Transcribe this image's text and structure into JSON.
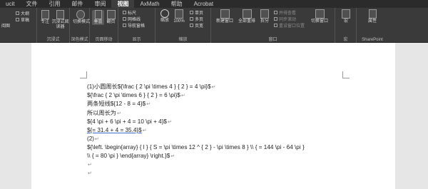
{
  "ribbon": {
    "tabs": [
      "ucit",
      "文件",
      "引用",
      "邮件",
      "审阅",
      "视图",
      "AxMath",
      "帮助",
      "Acrobat"
    ],
    "active_tab": "视图",
    "groups": {
      "immersive": {
        "label": "沉浸式",
        "buttons": [
          "专注",
          "沉浸式阅读器"
        ],
        "left_items": [
          "大纲",
          "草稿"
        ],
        "far_left": "阅图"
      },
      "dark": {
        "label": "深色模式",
        "buttons": [
          "切换模式"
        ]
      },
      "page_move": {
        "label": "页面移动",
        "buttons": [
          "垂直",
          "翻页"
        ]
      },
      "show": {
        "label": "显示",
        "checks": [
          "标尺",
          "网格线",
          "导航窗格"
        ]
      },
      "zoom": {
        "label": "缩放",
        "buttons": [
          "缩放",
          "100%"
        ],
        "items": [
          "单页",
          "多页",
          "页宽"
        ]
      },
      "window": {
        "label": "窗口",
        "buttons": [
          "新建窗口",
          "全部重排",
          "拆分"
        ],
        "items": [
          "并排查看",
          "同步滚动",
          "重设窗口位置"
        ],
        "switch": "切换窗口"
      },
      "macro": {
        "label": "宏",
        "buttons": [
          "宏"
        ]
      },
      "sharepoint": {
        "label": "SharePoint",
        "buttons": [
          "属性"
        ]
      }
    }
  },
  "document": {
    "lines": [
      "(1)小圆周长${\\frac { 2 \\pi \\times 4 } { 2 } = 4 \\pi}$",
      "${\\frac { 2 \\pi \\times 6 } { 2 } = 6 \\pi}$",
      "两条短线${12 - 8 = 4}$",
      "所以周长为",
      "${4 \\pi + 6 \\pi + 4 = 10 \\pi + 4}$",
      "${= 31.4 + 4 = 35.4}$",
      "(2)",
      "${\\left. \\begin{array}  { l }  { S = \\pi \\times 12 ^ { 2 } - \\pi \\times 8 } \\\\ { = 144 \\pi - 64 \\pi }",
      "\\\\ { = 80 \\pi } \\end{array} \\right.}$",
      "",
      ""
    ],
    "paragraph_mark": "↵"
  }
}
